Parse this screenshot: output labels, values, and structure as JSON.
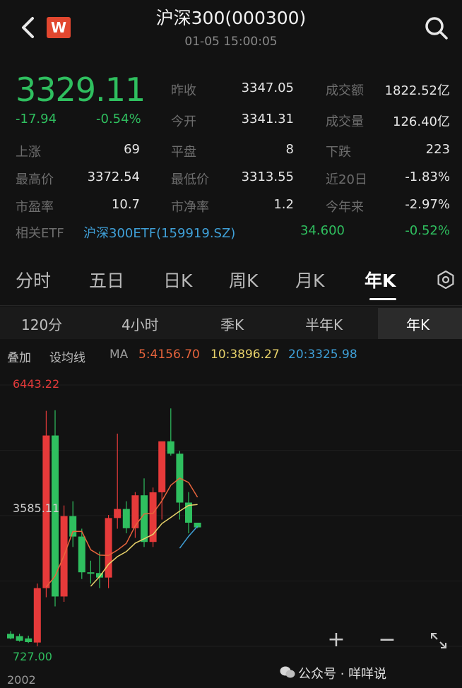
{
  "header": {
    "title": "沪深300(000300)",
    "timestamp": "01-05 15:00:05",
    "logo_letter": "W"
  },
  "quote": {
    "price": "3329.11",
    "change": "-17.94",
    "change_pct": "-0.54%",
    "stats": [
      {
        "label": "昨收",
        "value": "3347.05"
      },
      {
        "label": "成交额",
        "value": "1822.52亿"
      },
      {
        "label": "今开",
        "value": "3341.31"
      },
      {
        "label": "成交量",
        "value": "126.40亿"
      },
      {
        "label": "上涨",
        "value": "69"
      },
      {
        "label": "平盘",
        "value": "8"
      },
      {
        "label": "下跌",
        "value": "223"
      },
      {
        "label": "最高价",
        "value": "3372.54"
      },
      {
        "label": "最低价",
        "value": "3313.55"
      },
      {
        "label": "近20日",
        "value": "-1.83%"
      },
      {
        "label": "市盈率",
        "value": "10.7"
      },
      {
        "label": "市净率",
        "value": "1.2"
      },
      {
        "label": "今年来",
        "value": "-2.97%"
      }
    ],
    "etf": {
      "label": "相关ETF",
      "name": "沪深300ETF(159919.SZ)",
      "price": "34.600",
      "change": "-0.52%"
    }
  },
  "tabs": [
    "分时",
    "五日",
    "日K",
    "周K",
    "月K",
    "年K"
  ],
  "active_tab": "年K",
  "sub_tabs": [
    "120分",
    "4小时",
    "季K",
    "半年K",
    "年K"
  ],
  "active_sub_tab": "年K",
  "ma_bar": {
    "overlay": "叠加",
    "set_ma": "设均线",
    "ma": "MA",
    "ma5": "5:4156.70",
    "ma10": "10:3896.27",
    "ma20": "20:3325.98"
  },
  "colors": {
    "up": "#e63a3a",
    "down": "#2fbf5f",
    "ma5": "#e8643c",
    "ma10": "#e8d26a",
    "ma20": "#3fa0d8",
    "high_label": "#e63a3a",
    "low_label": "#2fbf5f"
  },
  "chart_data": {
    "type": "candlestick",
    "y_max_label": "6443.22",
    "y_mid_label": "3585.11",
    "y_min_label": "727.00",
    "x_start_label": "2002",
    "ylim": [
      727.0,
      6443.22
    ],
    "candles": [
      {
        "o": 1000,
        "h": 1060,
        "l": 880,
        "c": 900
      },
      {
        "o": 950,
        "h": 1000,
        "l": 830,
        "c": 850
      },
      {
        "o": 900,
        "h": 960,
        "l": 800,
        "c": 820
      },
      {
        "o": 810,
        "h": 2100,
        "l": 727,
        "c": 2000
      },
      {
        "o": 2000,
        "h": 5877,
        "l": 1800,
        "c": 5338
      },
      {
        "o": 5338,
        "h": 5891,
        "l": 1600,
        "c": 1817
      },
      {
        "o": 1817,
        "h": 3807,
        "l": 1700,
        "c": 3575
      },
      {
        "o": 3575,
        "h": 3900,
        "l": 2900,
        "c": 3128
      },
      {
        "o": 3128,
        "h": 3300,
        "l": 2200,
        "c": 2346
      },
      {
        "o": 2346,
        "h": 2600,
        "l": 2100,
        "c": 2330
      },
      {
        "o": 2330,
        "h": 2800,
        "l": 2000,
        "c": 2231
      },
      {
        "o": 2231,
        "h": 3600,
        "l": 2000,
        "c": 3533
      },
      {
        "o": 3533,
        "h": 5380,
        "l": 3300,
        "c": 3731
      },
      {
        "o": 3731,
        "h": 3900,
        "l": 3200,
        "c": 3310
      },
      {
        "o": 3310,
        "h": 4100,
        "l": 3100,
        "c": 4030
      },
      {
        "o": 4030,
        "h": 4400,
        "l": 2900,
        "c": 3010
      },
      {
        "o": 3010,
        "h": 4200,
        "l": 2900,
        "c": 4096
      },
      {
        "o": 4096,
        "h": 5200,
        "l": 3500,
        "c": 5211
      },
      {
        "o": 5211,
        "h": 5930,
        "l": 4900,
        "c": 4940
      },
      {
        "o": 4940,
        "h": 5000,
        "l": 3500,
        "c": 3871
      },
      {
        "o": 3871,
        "h": 4100,
        "l": 3200,
        "c": 3431
      },
      {
        "o": 3431,
        "h": 3430,
        "l": 3313,
        "c": 3329
      }
    ],
    "ma5": [
      null,
      null,
      null,
      null,
      2022,
      2265,
      2710,
      3239,
      3241,
      2839,
      2722,
      2714,
      2831,
      2979,
      3360,
      3622,
      3635,
      3909,
      4250,
      4406,
      4310,
      3989
    ],
    "ma10": [
      null,
      null,
      null,
      null,
      null,
      null,
      null,
      null,
      null,
      2040,
      2252,
      2520,
      2689,
      2799,
      2984,
      3078,
      3176,
      3413,
      3547,
      3686,
      3810,
      3828
    ],
    "ma20": [
      null,
      null,
      null,
      null,
      null,
      null,
      null,
      null,
      null,
      null,
      null,
      null,
      null,
      null,
      null,
      null,
      null,
      null,
      null,
      2873,
      3134,
      3354
    ]
  },
  "watermark": "公众号 · 咩咩说"
}
